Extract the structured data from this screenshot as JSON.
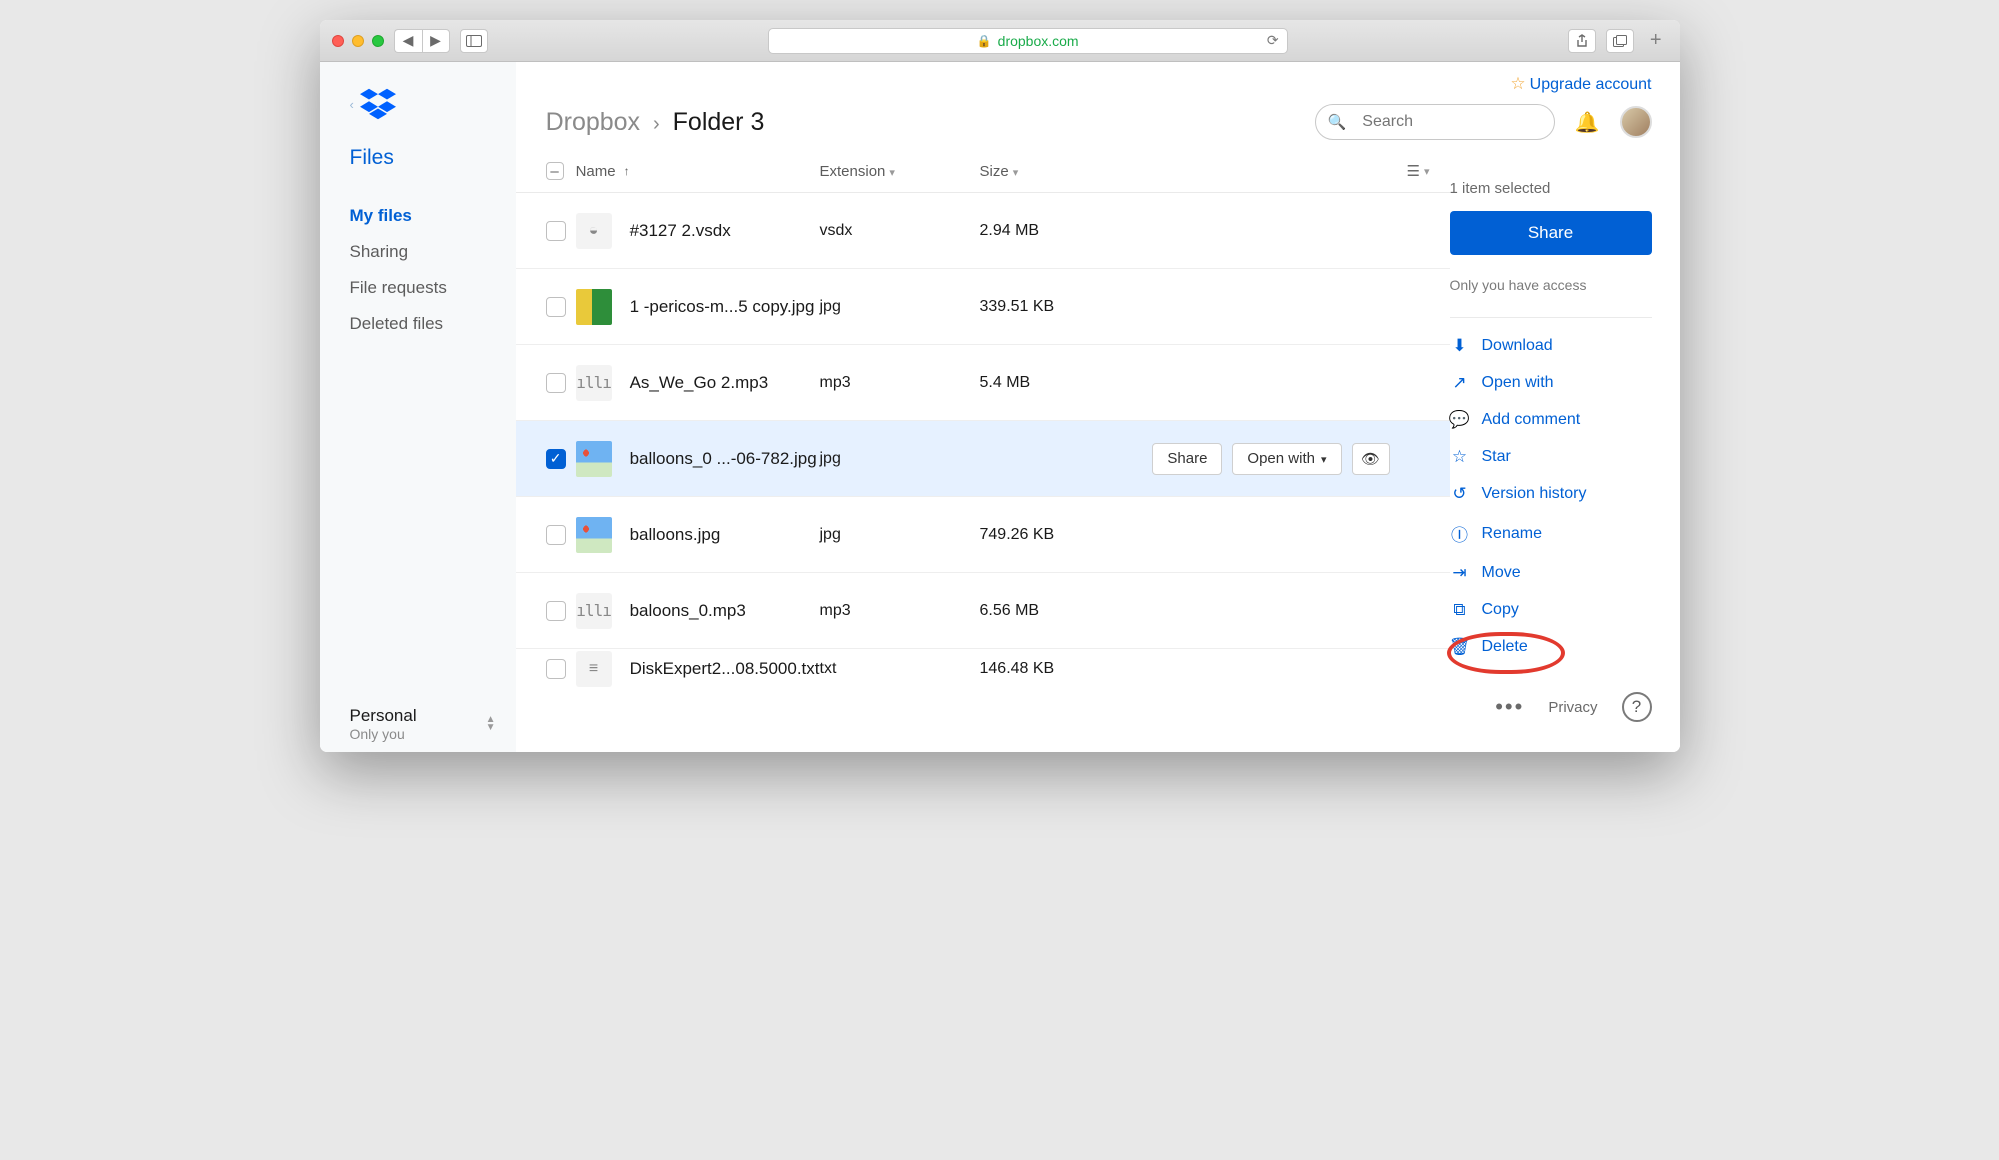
{
  "browser": {
    "url_host": "dropbox.com"
  },
  "upgrade_label": "Upgrade account",
  "sidebar": {
    "primary": "Files",
    "items": [
      {
        "label": "My files",
        "active": true
      },
      {
        "label": "Sharing",
        "active": false
      },
      {
        "label": "File requests",
        "active": false
      },
      {
        "label": "Deleted files",
        "active": false
      }
    ],
    "account_name": "Personal",
    "account_sub": "Only you"
  },
  "breadcrumb": {
    "root": "Dropbox",
    "current": "Folder 3"
  },
  "search": {
    "placeholder": "Search"
  },
  "columns": {
    "name": "Name",
    "ext": "Extension",
    "size": "Size"
  },
  "files": [
    {
      "name": "#3127 2.vsdx",
      "ext": "vsdx",
      "size": "2.94 MB",
      "icon": "generic",
      "selected": false
    },
    {
      "name": "1 -pericos-m...5 copy.jpg",
      "ext": "jpg",
      "size": "339.51 KB",
      "icon": "parrot",
      "selected": false
    },
    {
      "name": "As_We_Go 2.mp3",
      "ext": "mp3",
      "size": "5.4 MB",
      "icon": "audio",
      "selected": false
    },
    {
      "name": "balloons_0 ...-06-782.jpg",
      "ext": "jpg",
      "size": "",
      "icon": "sky",
      "selected": true
    },
    {
      "name": "balloons.jpg",
      "ext": "jpg",
      "size": "749.26 KB",
      "icon": "sky",
      "selected": false
    },
    {
      "name": "baloons_0.mp3",
      "ext": "mp3",
      "size": "6.56 MB",
      "icon": "audio",
      "selected": false
    },
    {
      "name": "DiskExpert2...08.5000.txt",
      "ext": "txt",
      "size": "146.48 KB",
      "icon": "text",
      "selected": false
    }
  ],
  "row_actions": {
    "share": "Share",
    "open_with": "Open with"
  },
  "side": {
    "selected": "1 item selected",
    "share": "Share",
    "access": "Only you have access",
    "actions": [
      {
        "key": "download",
        "label": "Download"
      },
      {
        "key": "openwith",
        "label": "Open with"
      },
      {
        "key": "comment",
        "label": "Add comment"
      },
      {
        "key": "star",
        "label": "Star"
      },
      {
        "key": "version",
        "label": "Version history"
      },
      {
        "key": "rename",
        "label": "Rename"
      },
      {
        "key": "move",
        "label": "Move"
      },
      {
        "key": "copy",
        "label": "Copy"
      },
      {
        "key": "delete",
        "label": "Delete"
      }
    ],
    "privacy": "Privacy"
  }
}
